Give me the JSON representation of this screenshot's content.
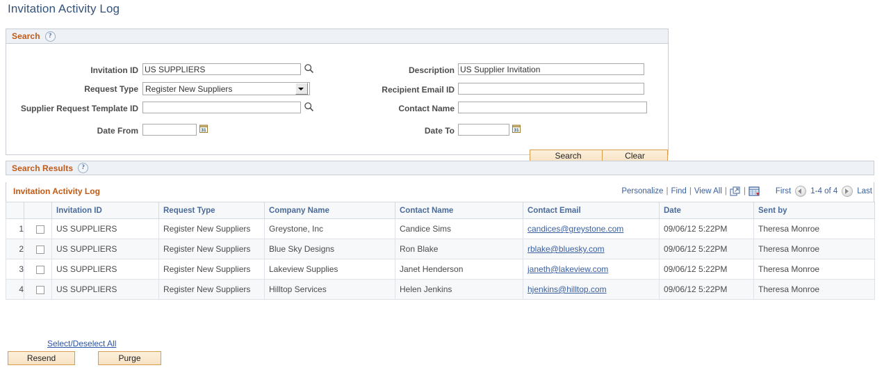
{
  "page": {
    "title": "Invitation Activity Log"
  },
  "search": {
    "panel_title": "Search",
    "help_icon": "?",
    "fields": {
      "invitation_id": {
        "label": "Invitation ID",
        "value": "US SUPPLIERS",
        "lookup_icon": "magnifier-icon"
      },
      "request_type": {
        "label": "Request Type",
        "value": "Register New Suppliers",
        "options": [
          "Register New Suppliers"
        ]
      },
      "supplier_request_template_id": {
        "label": "Supplier Request Template ID",
        "value": "",
        "lookup_icon": "magnifier-icon"
      },
      "date_from": {
        "label": "Date From",
        "value": "",
        "calendar_icon": "calendar-icon"
      },
      "description": {
        "label": "Description",
        "value": "US Supplier Invitation"
      },
      "recipient_email_id": {
        "label": "Recipient Email ID",
        "value": ""
      },
      "contact_name": {
        "label": "Contact Name",
        "value": ""
      },
      "date_to": {
        "label": "Date To",
        "value": "",
        "calendar_icon": "calendar-icon"
      }
    },
    "search_button": "Search",
    "clear_button": "Clear"
  },
  "results": {
    "panel_title": "Search Results",
    "help_icon": "?",
    "grid_caption": "Invitation Activity Log",
    "toolbar": {
      "personalize": "Personalize",
      "find": "Find",
      "view_all": "View All",
      "zoom_icon": "expand-grid-icon",
      "download_icon": "download-to-excel-icon"
    },
    "pager": {
      "first": "First",
      "prev_icon": "previous-page-icon",
      "range": "1-4 of 4",
      "next_icon": "next-page-icon",
      "last": "Last"
    },
    "columns": [
      "Invitation ID",
      "Request Type",
      "Company Name",
      "Contact Name",
      "Contact Email",
      "Date",
      "Sent by"
    ],
    "rows": [
      {
        "num": "1",
        "invitation_id": "US SUPPLIERS",
        "request_type": "Register New Suppliers",
        "company_name": "Greystone, Inc",
        "contact_name": "Candice Sims",
        "contact_email": "candices@greystone.com",
        "date": "09/06/12  5:22PM",
        "sent_by": "Theresa Monroe"
      },
      {
        "num": "2",
        "invitation_id": "US SUPPLIERS",
        "request_type": "Register New Suppliers",
        "company_name": "Blue Sky Designs",
        "contact_name": "Ron Blake",
        "contact_email": "rblake@bluesky.com",
        "date": "09/06/12  5:22PM",
        "sent_by": "Theresa Monroe"
      },
      {
        "num": "3",
        "invitation_id": "US SUPPLIERS",
        "request_type": "Register New Suppliers",
        "company_name": "Lakeview Supplies",
        "contact_name": "Janet Henderson",
        "contact_email": "janeth@lakeview.com",
        "date": "09/06/12  5:22PM",
        "sent_by": "Theresa Monroe"
      },
      {
        "num": "4",
        "invitation_id": "US SUPPLIERS",
        "request_type": "Register New Suppliers",
        "company_name": "Hilltop Services",
        "contact_name": "Helen Jenkins",
        "contact_email": "hjenkins@hilltop.com",
        "date": "09/06/12  5:22PM",
        "sent_by": "Theresa Monroe"
      }
    ]
  },
  "footer": {
    "select_deselect_all": "Select/Deselect All",
    "resend_button": "Resend",
    "purge_button": "Purge"
  },
  "colors": {
    "title_blue": "#33527a",
    "section_orange": "#c05a17",
    "header_blue": "#4a6b99",
    "link_blue": "#3a5f9e",
    "button_border": "#d99d4a"
  }
}
